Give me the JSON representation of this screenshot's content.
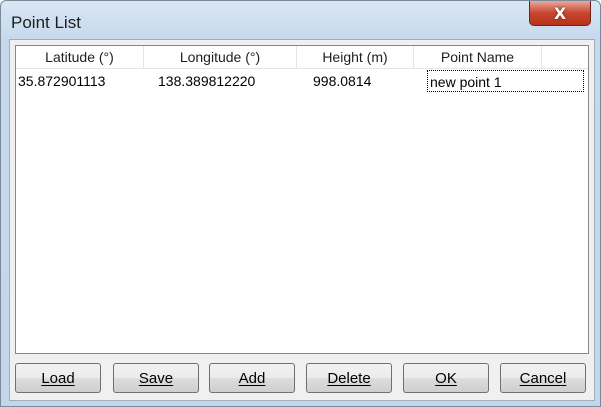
{
  "window": {
    "title": "Point List",
    "close_label": "X"
  },
  "list": {
    "columns": [
      "Latitude (°)",
      "Longitude (°)",
      "Height (m)",
      "Point Name"
    ],
    "rows": [
      {
        "latitude": "35.872901113",
        "longitude": "138.389812220",
        "height": "998.0814",
        "name": "new point 1"
      }
    ]
  },
  "buttons": {
    "load": "Load",
    "save": "Save",
    "add": "Add",
    "delete": "Delete",
    "ok": "OK",
    "cancel": "Cancel"
  },
  "colors": {
    "titlebar": "#c5d8ec",
    "close_button": "#c8452e",
    "dialog_background": "#f0f0f0"
  }
}
